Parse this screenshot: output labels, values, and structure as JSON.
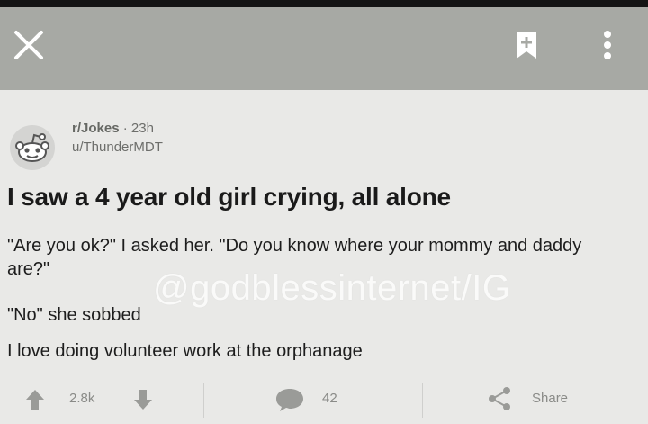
{
  "topbar": {
    "close_icon": "close-icon",
    "bookmark_icon": "bookmark-add-icon",
    "more_icon": "more-vertical-icon"
  },
  "post": {
    "subreddit": "r/Jokes",
    "separator": "·",
    "age": "23h",
    "author": "u/ThunderMDT",
    "title": "I saw a 4 year old girl crying, all alone",
    "paragraphs": [
      "\"Are you ok?\" I asked her. \"Do you know where your mommy and daddy are?\"",
      "\"No\" she sobbed",
      "I love doing volunteer work at the orphanage"
    ],
    "watermark": "@godblessinternet/IG"
  },
  "actions": {
    "score": "2.8k",
    "comments": "42",
    "share_label": "Share"
  },
  "colors": {
    "topbar": "#a7a9a4",
    "background": "#e9e9e7",
    "meta_text": "#6d6e6b"
  }
}
